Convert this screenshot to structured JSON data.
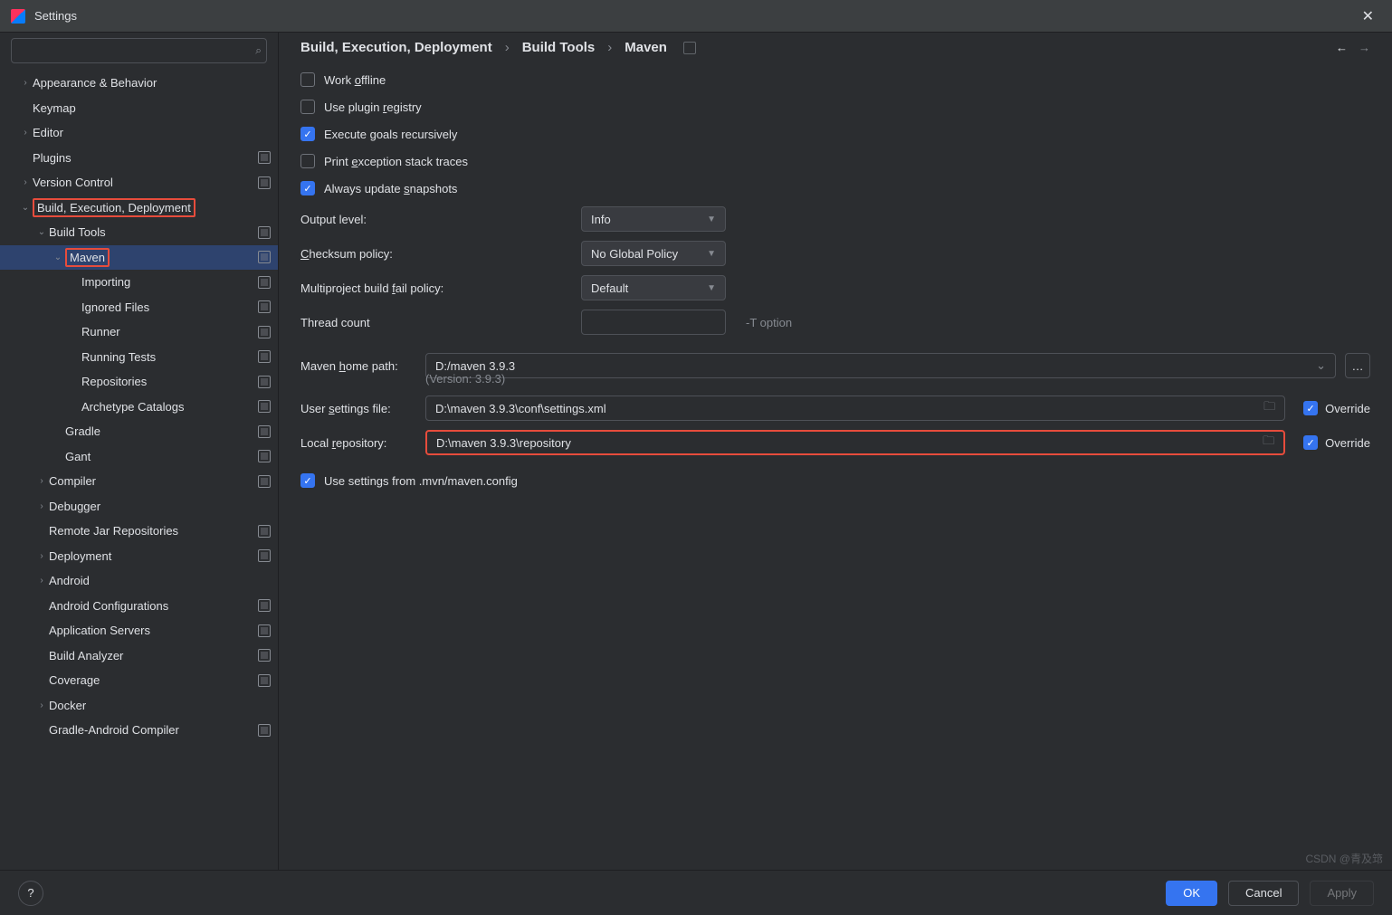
{
  "titlebar": {
    "title": "Settings"
  },
  "search": {
    "placeholder": ""
  },
  "tree": [
    {
      "label": "Appearance & Behavior",
      "indent": 0,
      "arrow": ">",
      "marker": false
    },
    {
      "label": "Keymap",
      "indent": 0,
      "arrow": "",
      "marker": false
    },
    {
      "label": "Editor",
      "indent": 0,
      "arrow": ">",
      "marker": false
    },
    {
      "label": "Plugins",
      "indent": 0,
      "arrow": "",
      "marker": true
    },
    {
      "label": "Version Control",
      "indent": 0,
      "arrow": ">",
      "marker": true
    },
    {
      "label": "Build, Execution, Deployment",
      "indent": 0,
      "arrow": "v",
      "marker": false,
      "redbox": true
    },
    {
      "label": "Build Tools",
      "indent": 1,
      "arrow": "v",
      "marker": true
    },
    {
      "label": "Maven",
      "indent": 2,
      "arrow": "v",
      "marker": true,
      "selected": true,
      "redbox": true
    },
    {
      "label": "Importing",
      "indent": 3,
      "arrow": "",
      "marker": true
    },
    {
      "label": "Ignored Files",
      "indent": 3,
      "arrow": "",
      "marker": true
    },
    {
      "label": "Runner",
      "indent": 3,
      "arrow": "",
      "marker": true
    },
    {
      "label": "Running Tests",
      "indent": 3,
      "arrow": "",
      "marker": true
    },
    {
      "label": "Repositories",
      "indent": 3,
      "arrow": "",
      "marker": true
    },
    {
      "label": "Archetype Catalogs",
      "indent": 3,
      "arrow": "",
      "marker": true
    },
    {
      "label": "Gradle",
      "indent": 2,
      "arrow": "",
      "marker": true
    },
    {
      "label": "Gant",
      "indent": 2,
      "arrow": "",
      "marker": true
    },
    {
      "label": "Compiler",
      "indent": 1,
      "arrow": ">",
      "marker": true
    },
    {
      "label": "Debugger",
      "indent": 1,
      "arrow": ">",
      "marker": false
    },
    {
      "label": "Remote Jar Repositories",
      "indent": 1,
      "arrow": "",
      "marker": true
    },
    {
      "label": "Deployment",
      "indent": 1,
      "arrow": ">",
      "marker": true
    },
    {
      "label": "Android",
      "indent": 1,
      "arrow": ">",
      "marker": false
    },
    {
      "label": "Android Configurations",
      "indent": 1,
      "arrow": "",
      "marker": true
    },
    {
      "label": "Application Servers",
      "indent": 1,
      "arrow": "",
      "marker": true
    },
    {
      "label": "Build Analyzer",
      "indent": 1,
      "arrow": "",
      "marker": true
    },
    {
      "label": "Coverage",
      "indent": 1,
      "arrow": "",
      "marker": true
    },
    {
      "label": "Docker",
      "indent": 1,
      "arrow": ">",
      "marker": false
    },
    {
      "label": "Gradle-Android Compiler",
      "indent": 1,
      "arrow": "",
      "marker": true
    }
  ],
  "breadcrumb": [
    "Build, Execution, Deployment",
    "Build Tools",
    "Maven"
  ],
  "checks": {
    "work_offline": {
      "label_pre": "Work ",
      "u": "o",
      "label_post": "ffline",
      "checked": false
    },
    "use_plugin_registry": {
      "label_pre": "Use plugin ",
      "u": "r",
      "label_post": "egistry",
      "checked": false
    },
    "execute_goals": {
      "label_pre": "Execute ",
      "u": "g",
      "label_post": "oals recursively",
      "checked": true
    },
    "print_exception": {
      "label_pre": "Print ",
      "u": "e",
      "label_post": "xception stack traces",
      "checked": false
    },
    "always_update": {
      "label_pre": "Always update ",
      "u": "s",
      "label_post": "napshots",
      "checked": true
    },
    "use_settings_mvn": {
      "label": "Use settings from .mvn/maven.config",
      "checked": true
    }
  },
  "fields": {
    "output_level": {
      "label": "Output level:",
      "value": "Info"
    },
    "checksum": {
      "label_pre": "",
      "u": "C",
      "label_post": "hecksum policy:",
      "value": "No Global Policy"
    },
    "multiproject": {
      "label_pre": "Multiproject build ",
      "u": "f",
      "label_post": "ail policy:",
      "value": "Default"
    },
    "thread_count": {
      "label": "Thread count",
      "value": "",
      "hint": "-T option"
    },
    "maven_home": {
      "label_pre": "Maven ",
      "u": "h",
      "label_post": "ome path:",
      "value": "D:/maven 3.9.3",
      "version": "(Version: 3.9.3)"
    },
    "user_settings": {
      "label_pre": "User ",
      "u": "s",
      "label_post": "ettings file:",
      "value": "D:\\maven 3.9.3\\conf\\settings.xml",
      "override": true,
      "override_label": "Override"
    },
    "local_repo": {
      "label_pre": "Local ",
      "u": "r",
      "label_post": "epository:",
      "value": "D:\\maven 3.9.3\\repository",
      "override": true,
      "override_label": "Override"
    }
  },
  "footer": {
    "ok": "OK",
    "cancel": "Cancel",
    "apply": "Apply"
  },
  "watermark": "CSDN @青及筇"
}
